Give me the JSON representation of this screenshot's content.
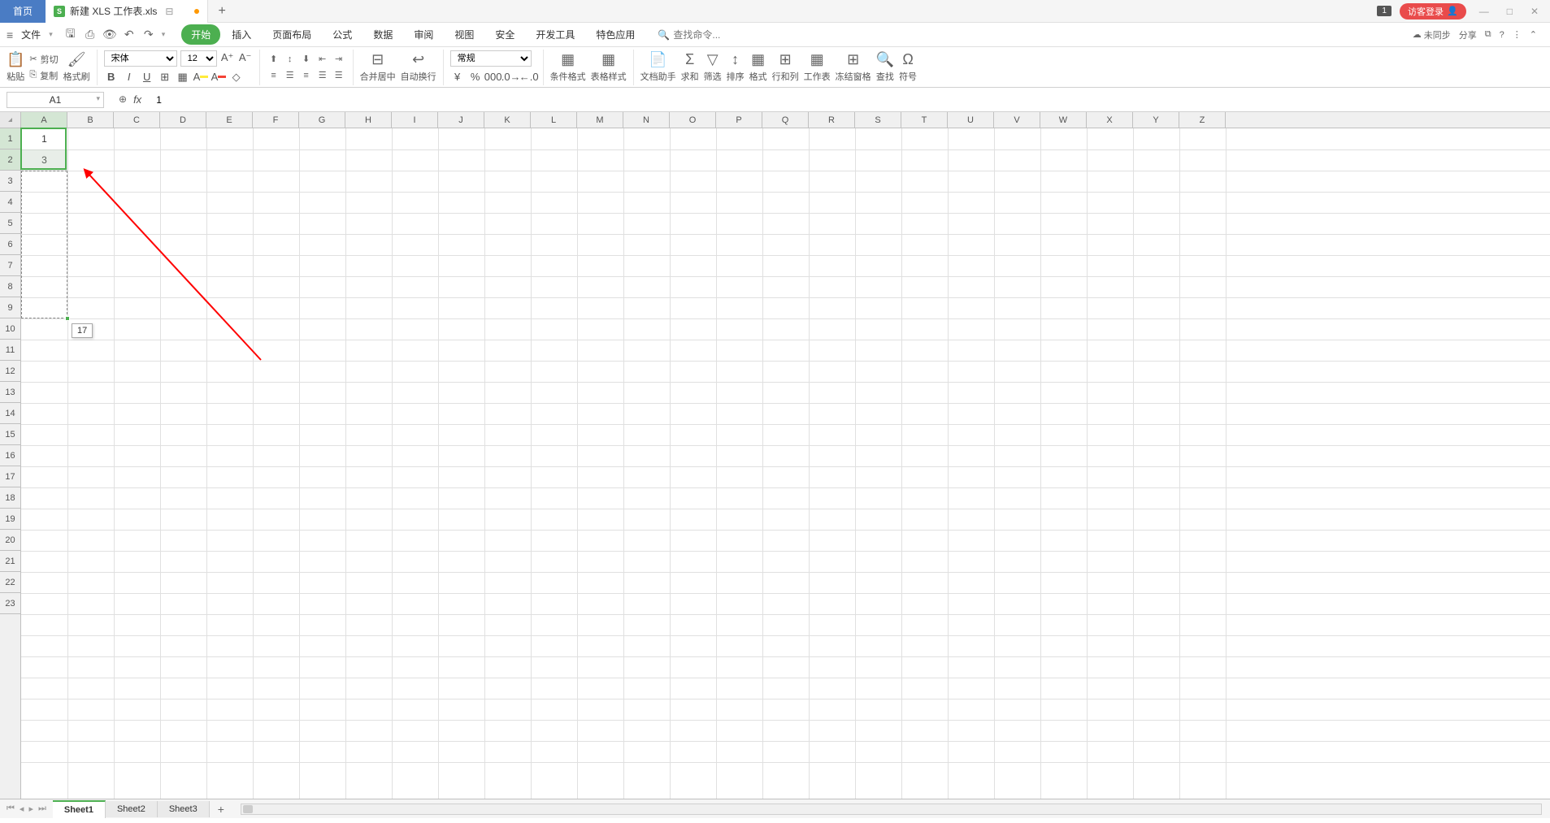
{
  "titlebar": {
    "home_tab": "首页",
    "doc_name": "新建 XLS 工作表.xls",
    "badge": "1",
    "login": "访客登录"
  },
  "menubar": {
    "file": "文件",
    "tabs": [
      "开始",
      "插入",
      "页面布局",
      "公式",
      "数据",
      "审阅",
      "视图",
      "安全",
      "开发工具",
      "特色应用"
    ],
    "search_placeholder": "查找命令...",
    "sync": "未同步",
    "share": "分享"
  },
  "ribbon": {
    "paste": "粘贴",
    "cut": "剪切",
    "copy": "复制",
    "format_painter": "格式刷",
    "font_name": "宋体",
    "font_size": "12",
    "merge": "合并居中",
    "wrap": "自动换行",
    "number_format": "常规",
    "cond_format": "条件格式",
    "table_style": "表格样式",
    "doc_helper": "文档助手",
    "sum": "求和",
    "filter": "筛选",
    "sort": "排序",
    "format": "格式",
    "row_col": "行和列",
    "worksheet": "工作表",
    "freeze": "冻结窗格",
    "find": "查找",
    "symbol": "符号"
  },
  "formulabar": {
    "cell_ref": "A1",
    "formula": "1"
  },
  "columns": [
    "A",
    "B",
    "C",
    "D",
    "E",
    "F",
    "G",
    "H",
    "I",
    "J",
    "K",
    "L",
    "M",
    "N",
    "O",
    "P",
    "Q",
    "R",
    "S",
    "T",
    "U",
    "V",
    "W",
    "X",
    "Y",
    "Z"
  ],
  "rows": [
    "1",
    "2",
    "3",
    "4",
    "5",
    "6",
    "7",
    "8",
    "9",
    "10",
    "11",
    "12",
    "13",
    "14",
    "15",
    "16",
    "17",
    "18",
    "19",
    "20",
    "21",
    "22",
    "23"
  ],
  "cell_data": {
    "A1": "1",
    "A2": "3"
  },
  "tooltip": "17",
  "sheets": [
    "Sheet1",
    "Sheet2",
    "Sheet3"
  ]
}
